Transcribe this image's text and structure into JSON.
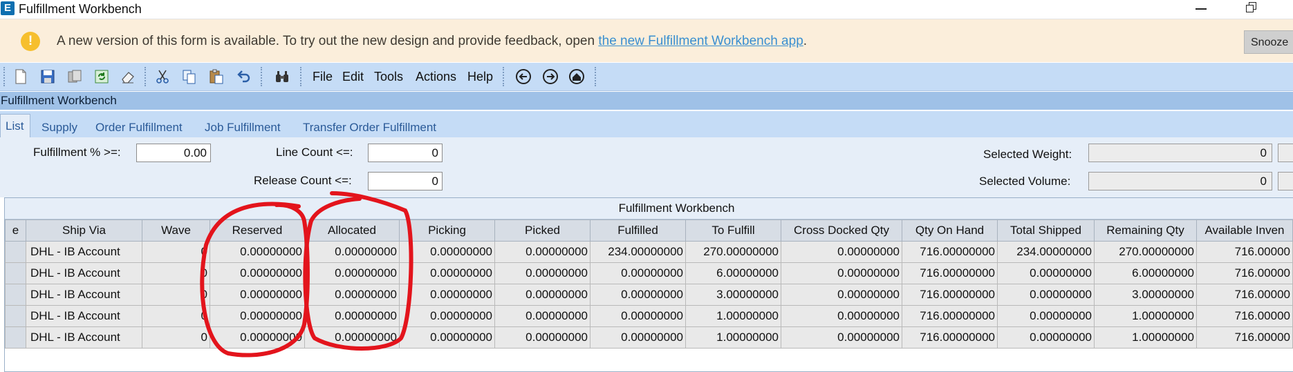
{
  "window": {
    "app_icon_letter": "E",
    "title": "Fulfillment Workbench"
  },
  "banner": {
    "icon": "!",
    "message": "A new version of this form is available. To try out the new design and provide feedback, open ",
    "link": "the new Fulfillment Workbench app",
    "suffix": ".",
    "snooze_label": "Snooze"
  },
  "toolbar": {
    "icons": [
      "new-icon",
      "save-icon",
      "copy-record-icon",
      "refresh-icon",
      "clear-icon",
      "cut-icon",
      "copy-icon",
      "paste-icon",
      "undo-icon",
      "find-icon",
      "back-icon",
      "forward-icon",
      "home-icon"
    ],
    "menus": [
      "File",
      "Edit",
      "Tools",
      "Actions",
      "Help"
    ]
  },
  "section": {
    "title": "Fulfillment Workbench"
  },
  "tabs": [
    "List",
    "Supply",
    "Order Fulfillment",
    "Job Fulfillment",
    "Transfer Order Fulfillment"
  ],
  "active_tab": "List",
  "filters": {
    "fulfillment_pct_label": "Fulfillment % >=:",
    "fulfillment_pct_value": "0.00",
    "line_count_label": "Line Count <=:",
    "line_count_value": "0",
    "release_count_label": "Release Count <=:",
    "release_count_value": "0",
    "selected_weight_label": "Selected Weight:",
    "selected_weight_value": "0",
    "selected_volume_label": "Selected Volume:",
    "selected_volume_value": "0"
  },
  "grid": {
    "caption": "Fulfillment Workbench",
    "columns": [
      "e",
      "Ship Via",
      "Wave",
      "Reserved",
      "Allocated",
      "Picking",
      "Picked",
      "Fulfilled",
      "To Fulfill",
      "Cross Docked Qty",
      "Qty On Hand",
      "Total Shipped",
      "Remaining Qty",
      "Available Inven"
    ],
    "rows": [
      [
        "",
        "DHL - IB Account",
        "0",
        "0.00000000",
        "0.00000000",
        "0.00000000",
        "0.00000000",
        "234.00000000",
        "270.00000000",
        "0.00000000",
        "716.00000000",
        "234.00000000",
        "270.00000000",
        "716.00000"
      ],
      [
        "",
        "DHL - IB Account",
        "0",
        "0.00000000",
        "0.00000000",
        "0.00000000",
        "0.00000000",
        "0.00000000",
        "6.00000000",
        "0.00000000",
        "716.00000000",
        "0.00000000",
        "6.00000000",
        "716.00000"
      ],
      [
        "",
        "DHL - IB Account",
        "0",
        "0.00000000",
        "0.00000000",
        "0.00000000",
        "0.00000000",
        "0.00000000",
        "3.00000000",
        "0.00000000",
        "716.00000000",
        "0.00000000",
        "3.00000000",
        "716.00000"
      ],
      [
        "",
        "DHL - IB Account",
        "0",
        "0.00000000",
        "0.00000000",
        "0.00000000",
        "0.00000000",
        "0.00000000",
        "1.00000000",
        "0.00000000",
        "716.00000000",
        "0.00000000",
        "1.00000000",
        "716.00000"
      ],
      [
        "",
        "DHL - IB Account",
        "0",
        "0.00000000",
        "0.00000000",
        "0.00000000",
        "0.00000000",
        "0.00000000",
        "1.00000000",
        "0.00000000",
        "716.00000000",
        "0.00000000",
        "1.00000000",
        "716.00000"
      ]
    ]
  },
  "colors": {
    "banner_bg": "#fbeedb",
    "toolbar_bg": "#c5dcf6",
    "header_bg": "#9fc1e7",
    "link": "#3a8fd0",
    "annotation": "#e3141c"
  }
}
